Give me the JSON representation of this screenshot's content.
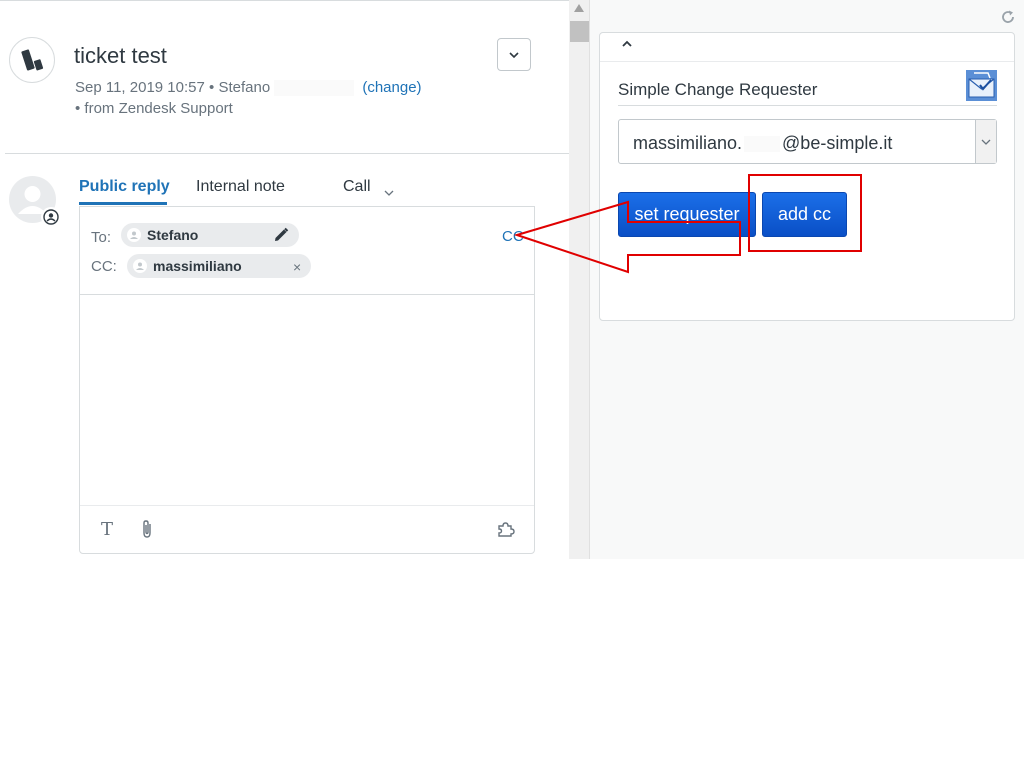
{
  "ticket": {
    "title": "ticket test",
    "date": "Sep 11, 2019 10:57",
    "bullet": "•",
    "requester_first": "Stefano",
    "change_label": "(change)",
    "source_line": "• from Zendesk Support"
  },
  "composer": {
    "tabs": {
      "public_reply": "Public reply",
      "internal_note": "Internal note",
      "call": "Call"
    },
    "to_label": "To:",
    "cc_label": "CC:",
    "to_chip": "Stefano",
    "cc_chip": "massimiliano",
    "cc_link": "CC",
    "remove_symbol": "×",
    "format_symbol": "T"
  },
  "app": {
    "title": "Simple Change Requester",
    "email_start": "massimiliano.",
    "email_end": "@be-simple.it",
    "set_requester_label": "set requester",
    "add_cc_label": "add cc"
  },
  "colors": {
    "accent": "#1f73b7",
    "button_blue": "#0a56d1",
    "annotation_red": "#e00000"
  },
  "icons": [
    "zendesk-logo",
    "chevron-down-icon",
    "user-avatar-icon",
    "pencil-icon",
    "paperclip-icon",
    "puzzle-icon",
    "refresh-icon",
    "chevron-up-icon",
    "app-logo-icon"
  ]
}
